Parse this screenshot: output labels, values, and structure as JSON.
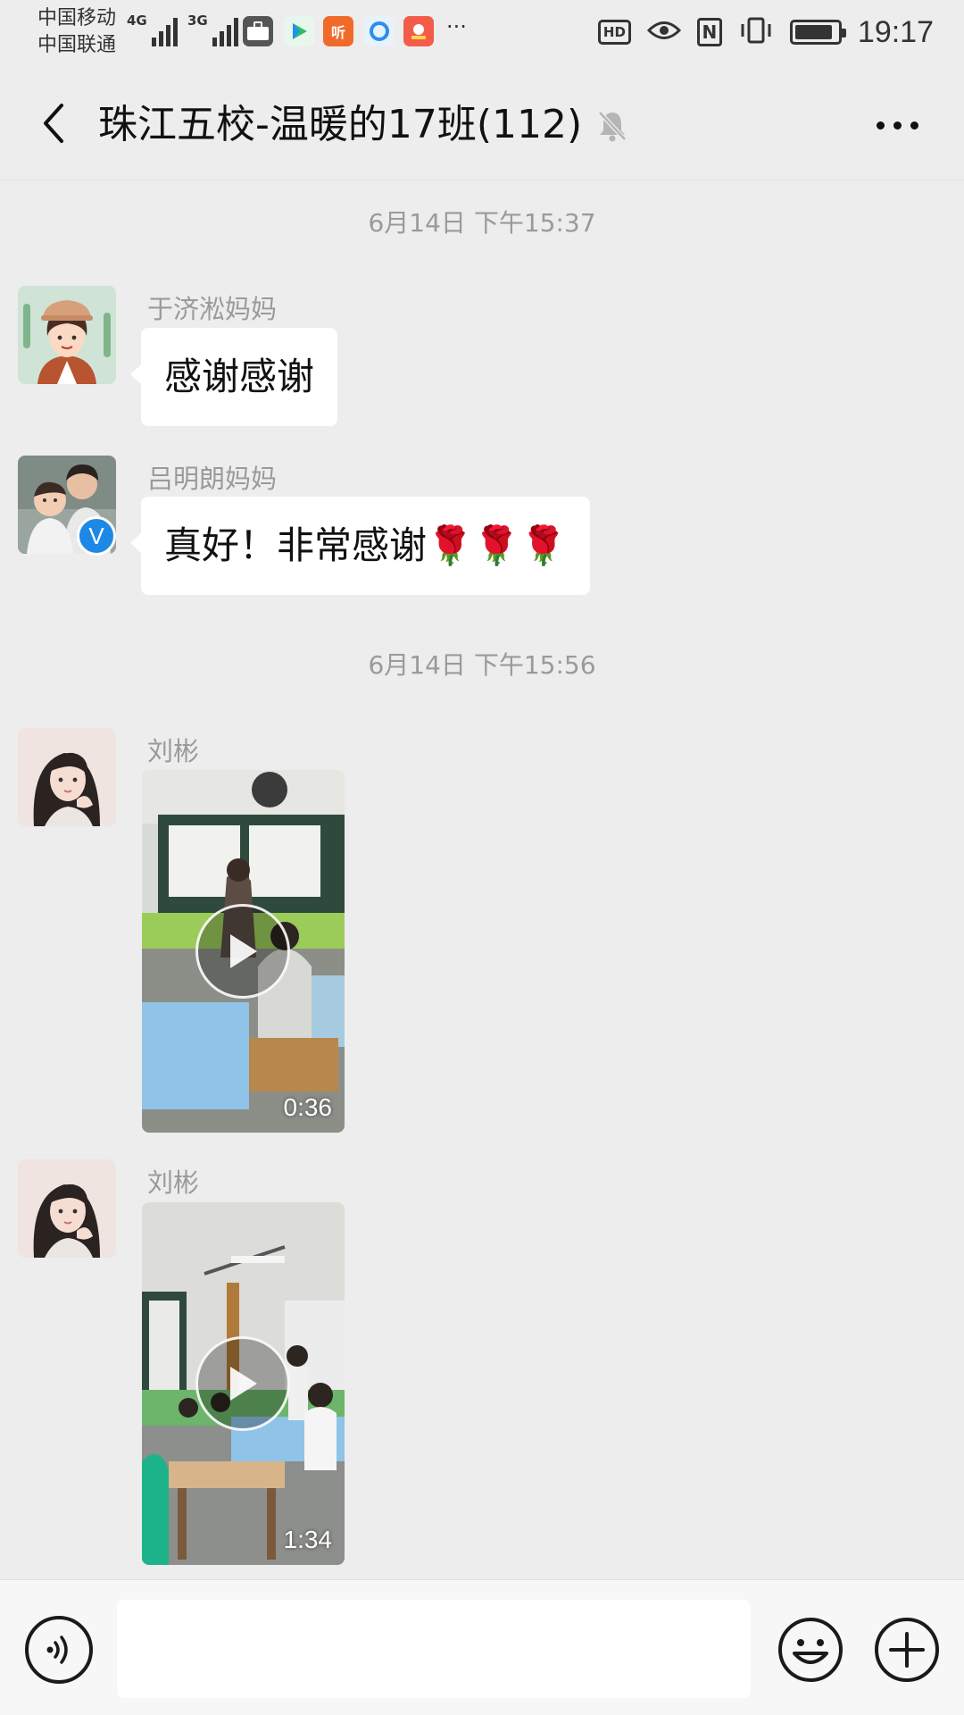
{
  "status_bar": {
    "carrier_1": "中国移动",
    "carrier_2": "中国联通",
    "net_1": "4G",
    "net_2": "3G",
    "app_listen_label": "听",
    "more_notifications": "···",
    "hd_label": "HD",
    "nfc_label": "N",
    "time": "19:17",
    "battery_level": 0.9
  },
  "header": {
    "title": "珠江五校-温暖的17班(112)",
    "muted": true
  },
  "messages": [
    {
      "type": "timestamp",
      "text": "6月14日 下午15:37"
    },
    {
      "type": "text",
      "sender": "于济淞妈妈",
      "text": "感谢感谢",
      "avatar": "cartoon-woman-hat-avatar"
    },
    {
      "type": "text",
      "sender": "吕明朗妈妈",
      "text": "真好！非常感谢🌹🌹🌹",
      "avatar": "mother-child-photo-avatar",
      "verified_badge": "V"
    },
    {
      "type": "timestamp",
      "text": "6月14日 下午15:56"
    },
    {
      "type": "video",
      "sender": "刘彬",
      "duration": "0:36",
      "avatar": "girl-illustration-avatar"
    },
    {
      "type": "video",
      "sender": "刘彬",
      "duration": "1:34",
      "avatar": "girl-illustration-avatar"
    }
  ],
  "input_bar": {
    "placeholder": "",
    "value": ""
  },
  "colors": {
    "background": "#ededed",
    "bubble": "#ffffff",
    "meta_text": "#9a9a9a",
    "verified_badge": "#1e88e5"
  }
}
